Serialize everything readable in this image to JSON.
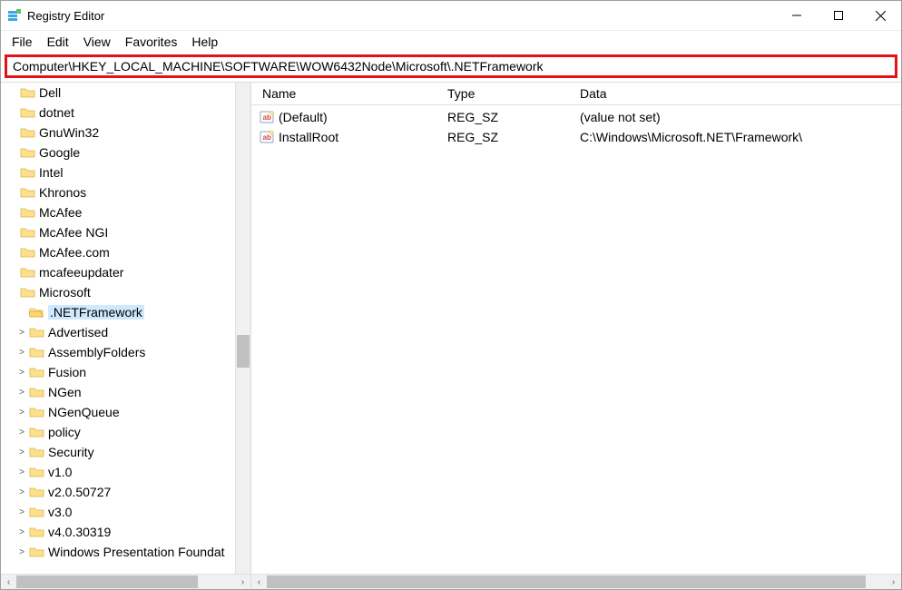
{
  "window": {
    "title": "Registry Editor"
  },
  "menu": {
    "items": [
      "File",
      "Edit",
      "View",
      "Favorites",
      "Help"
    ]
  },
  "address": {
    "value": "Computer\\HKEY_LOCAL_MACHINE\\SOFTWARE\\WOW6432Node\\Microsoft\\.NETFramework"
  },
  "tree": {
    "items": [
      {
        "label": "Dell",
        "indent": 1,
        "expander": ""
      },
      {
        "label": "dotnet",
        "indent": 1,
        "expander": ""
      },
      {
        "label": "GnuWin32",
        "indent": 1,
        "expander": ""
      },
      {
        "label": "Google",
        "indent": 1,
        "expander": ""
      },
      {
        "label": "Intel",
        "indent": 1,
        "expander": ""
      },
      {
        "label": "Khronos",
        "indent": 1,
        "expander": ""
      },
      {
        "label": "McAfee",
        "indent": 1,
        "expander": ""
      },
      {
        "label": "McAfee NGI",
        "indent": 1,
        "expander": ""
      },
      {
        "label": "McAfee.com",
        "indent": 1,
        "expander": ""
      },
      {
        "label": "mcafeeupdater",
        "indent": 1,
        "expander": ""
      },
      {
        "label": "Microsoft",
        "indent": 1,
        "expander": ""
      },
      {
        "label": ".NETFramework",
        "indent": 2,
        "expander": "",
        "selected": true,
        "open": true
      },
      {
        "label": "Advertised",
        "indent": 2,
        "expander": ">"
      },
      {
        "label": "AssemblyFolders",
        "indent": 2,
        "expander": ">"
      },
      {
        "label": "Fusion",
        "indent": 2,
        "expander": ">"
      },
      {
        "label": "NGen",
        "indent": 2,
        "expander": ">"
      },
      {
        "label": "NGenQueue",
        "indent": 2,
        "expander": ">"
      },
      {
        "label": "policy",
        "indent": 2,
        "expander": ">"
      },
      {
        "label": "Security",
        "indent": 2,
        "expander": ">"
      },
      {
        "label": "v1.0",
        "indent": 2,
        "expander": ">"
      },
      {
        "label": "v2.0.50727",
        "indent": 2,
        "expander": ">"
      },
      {
        "label": "v3.0",
        "indent": 2,
        "expander": ">"
      },
      {
        "label": "v4.0.30319",
        "indent": 2,
        "expander": ">"
      },
      {
        "label": "Windows Presentation Foundat",
        "indent": 2,
        "expander": ">"
      }
    ]
  },
  "list": {
    "columns": {
      "name": "Name",
      "type": "Type",
      "data": "Data"
    },
    "rows": [
      {
        "name": "(Default)",
        "type": "REG_SZ",
        "data": "(value not set)"
      },
      {
        "name": "InstallRoot",
        "type": "REG_SZ",
        "data": "C:\\Windows\\Microsoft.NET\\Framework\\"
      }
    ]
  }
}
